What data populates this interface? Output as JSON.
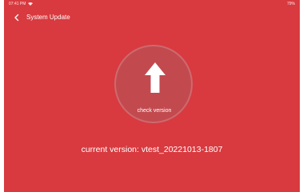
{
  "status_bar": {
    "time": "07:41 PM",
    "battery": "79%"
  },
  "header": {
    "title": "System Update"
  },
  "check": {
    "label": "check version"
  },
  "version": {
    "text": "current version: vtest_20221013-1807"
  },
  "colors": {
    "background": "#d83a3f",
    "circle": "#c24a4f",
    "text": "#ffffff"
  },
  "icons": {
    "back": "chevron-left-icon",
    "update": "upload-arrow-icon",
    "wifi": "wifi-icon"
  }
}
